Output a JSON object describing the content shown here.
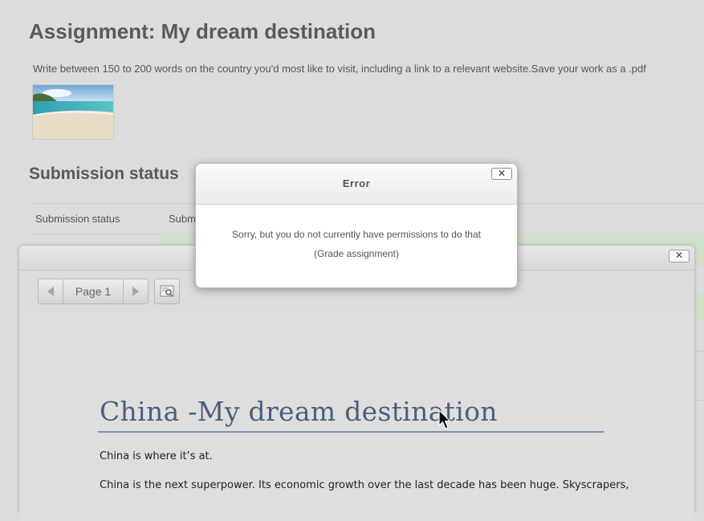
{
  "page": {
    "title": "Assignment: My dream destination",
    "intro": "Write between 150 to 200 words on the country you'd most like to visit, including a link to a relevant website.Save your work as a .pdf",
    "submission_heading": "Submission status",
    "status_rows": [
      {
        "label": "Submission status",
        "value": "Subm"
      }
    ]
  },
  "grader": {
    "page_label": "Page 1",
    "document": {
      "title": "China -My dream destination",
      "paragraphs": [
        "China is where it’s at.",
        "China is the next superpower. Its economic growth over the last decade has been huge. Skyscrapers,"
      ]
    }
  },
  "error_dialog": {
    "title": "Error",
    "close_label": "✕",
    "message_line1": "Sorry, but you do not currently have permissions to do that",
    "message_line2": "(Grade assignment)"
  },
  "icons": {
    "prev": "chevron-left-icon",
    "next": "chevron-right-icon",
    "search": "search-comments-icon",
    "close": "close-icon",
    "cursor": "mouse-pointer-icon"
  },
  "colors": {
    "accent_title": "#4a5f7c",
    "success_row": "#cfe1c9"
  }
}
